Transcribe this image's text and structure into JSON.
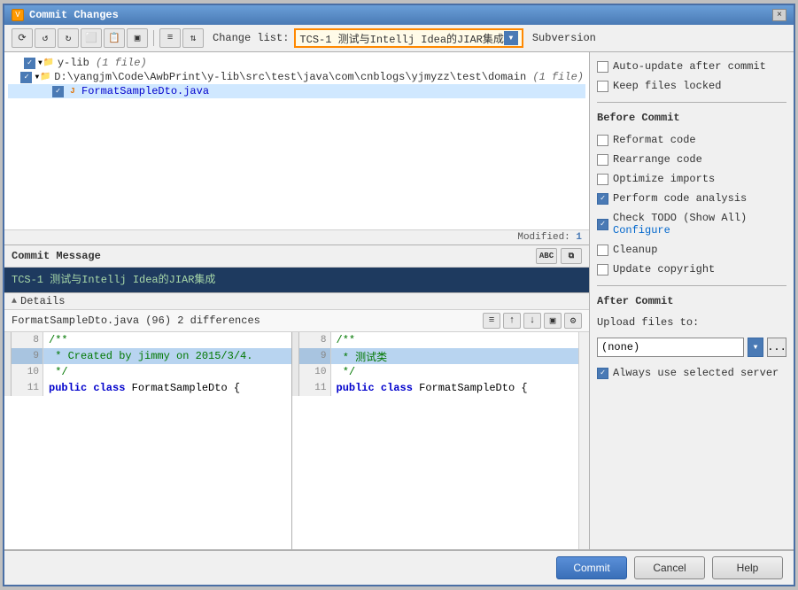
{
  "window": {
    "title": "Commit Changes",
    "close_label": "×"
  },
  "toolbar": {
    "buttons": [
      "⟳",
      "↺",
      "↻",
      "⬜",
      "📋",
      "▣",
      "≡",
      "⇅"
    ],
    "changelist_label": "Change list:",
    "changelist_value": "TCS-1 测试与Intellj Idea的JIAR集成",
    "subversion_label": "Subversion"
  },
  "right_panel": {
    "auto_update_label": "Auto-update after commit",
    "keep_locked_label": "Keep files locked",
    "before_commit_title": "Before Commit",
    "reformat_label": "Reformat code",
    "rearrange_label": "Rearrange code",
    "optimize_label": "Optimize imports",
    "perform_label": "Perform code analysis",
    "check_todo_label": "Check TODO (Show All)",
    "configure_label": "Configure",
    "cleanup_label": "Cleanup",
    "update_copyright_label": "Update copyright",
    "after_commit_title": "After Commit",
    "upload_label": "Upload files to:",
    "none_label": "(none)",
    "always_use_label": "Always use selected server"
  },
  "file_tree": {
    "root_label": "y-lib",
    "root_count": "(1 file)",
    "path_label": "D:\\yangjm\\Code\\AwbPrint\\y-lib\\src\\test\\java\\com\\cnblogs\\yjmyzz\\test\\domain",
    "path_count": "(1 file)",
    "file_label": "FormatSampleDto.java"
  },
  "modified": {
    "label": "Modified:",
    "count": "1"
  },
  "commit_message": {
    "header": "Commit Message",
    "value": "TCS-1 测试与Intellj Idea的JIAR集成",
    "abc_label": "ABC"
  },
  "details": {
    "header": "Details",
    "filename": "FormatSampleDto.java (96) 2 differences"
  },
  "diff": {
    "left_lines": [
      {
        "num": "8",
        "code": "/**",
        "type": "normal"
      },
      {
        "num": "9",
        "code": " * Created by jimmy on 2015/3/4.",
        "type": "highlight"
      },
      {
        "num": "10",
        "code": " */",
        "type": "normal"
      },
      {
        "num": "11",
        "code": "public class FormatSampleDto {",
        "type": "normal"
      }
    ],
    "right_lines": [
      {
        "num": "8",
        "code": "/**",
        "type": "normal"
      },
      {
        "num": "9",
        "code": " * 测试类",
        "type": "highlight"
      },
      {
        "num": "10",
        "code": " */",
        "type": "normal"
      },
      {
        "num": "11",
        "code": "public class FormatSampleDto {",
        "type": "normal"
      }
    ]
  },
  "footer": {
    "commit_label": "Commit",
    "cancel_label": "Cancel",
    "help_label": "Help"
  }
}
